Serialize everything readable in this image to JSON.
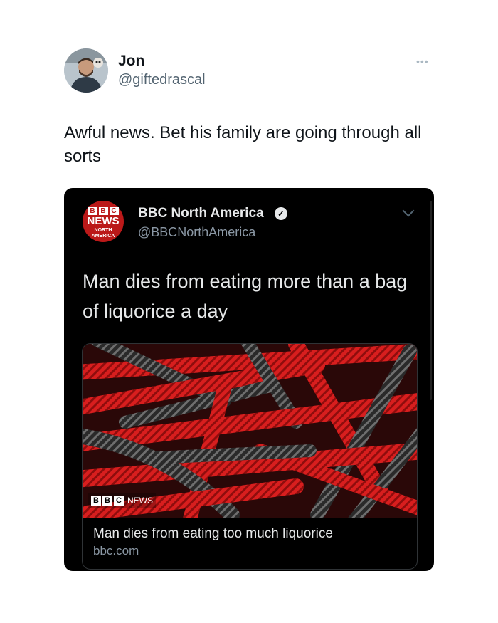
{
  "tweet": {
    "author_name": "Jon",
    "author_handle": "@giftedrascal",
    "more_label": "•••",
    "text": "Awful news. Bet his family are going through all sorts"
  },
  "quoted_tweet": {
    "logo": {
      "blocks": [
        "B",
        "B",
        "C"
      ],
      "news": "NEWS",
      "region_line1": "NORTH",
      "region_line2": "AMERICA"
    },
    "author_name": "BBC North America",
    "verified_mark": "✓",
    "author_handle": "@BBCNorthAmerica",
    "text": "Man dies from eating more than a bag of liquorice a day",
    "link_card": {
      "badge_blocks": [
        "B",
        "B",
        "C"
      ],
      "badge_word": "NEWS",
      "title": "Man dies from eating too much liquorice",
      "domain": "bbc.com"
    }
  },
  "colors": {
    "bbc_red": "#bb1919",
    "liquorice_red": "#d81e1e",
    "liquorice_black": "#1c1c1c"
  }
}
